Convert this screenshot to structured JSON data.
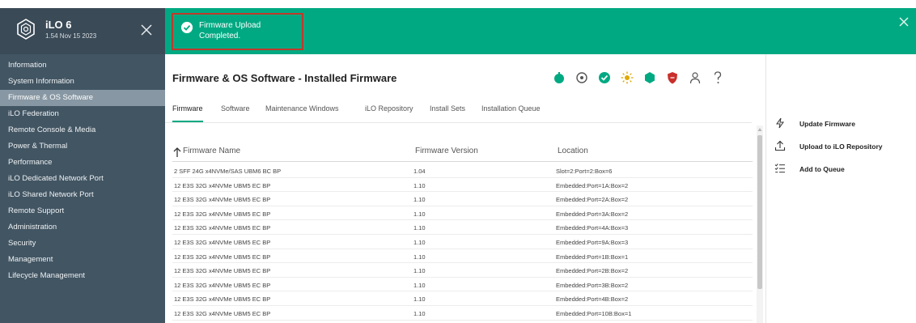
{
  "app": {
    "name": "iLO 6",
    "version": "1.54 Nov 15 2023"
  },
  "sidebar": {
    "items": [
      {
        "label": "Information",
        "active": false
      },
      {
        "label": "System Information",
        "active": false
      },
      {
        "label": "Firmware & OS Software",
        "active": true
      },
      {
        "label": "iLO Federation",
        "active": false
      },
      {
        "label": "Remote Console & Media",
        "active": false
      },
      {
        "label": "Power & Thermal",
        "active": false
      },
      {
        "label": "Performance",
        "active": false
      },
      {
        "label": "iLO Dedicated Network Port",
        "active": false
      },
      {
        "label": "iLO Shared Network Port",
        "active": false
      },
      {
        "label": "Remote Support",
        "active": false
      },
      {
        "label": "Administration",
        "active": false
      },
      {
        "label": "Security",
        "active": false
      },
      {
        "label": "Management",
        "active": false
      },
      {
        "label": "Lifecycle Management",
        "active": false
      }
    ]
  },
  "toast": {
    "message": "Firmware Upload Completed."
  },
  "main": {
    "title": "Firmware & OS Software - Installed Firmware",
    "tabs": [
      {
        "label": "Firmware",
        "active": true
      },
      {
        "label": "Software",
        "active": false
      },
      {
        "label": "Maintenance Windows",
        "active": false
      },
      {
        "label": "iLO Repository",
        "active": false
      },
      {
        "label": "Install Sets",
        "active": false
      },
      {
        "label": "Installation Queue",
        "active": false
      }
    ],
    "table": {
      "headers": [
        "Firmware Name",
        "Firmware Version",
        "Location"
      ],
      "rows": [
        [
          "2 SFF 24G x4NVMe/SAS UBM6 BC BP",
          "1.04",
          "Slot=2:Port=2:Box=6"
        ],
        [
          "12 E3S 32G x4NVMe UBM5 EC BP",
          "1.10",
          "Embedded:Port=1A:Box=2"
        ],
        [
          "12 E3S 32G x4NVMe UBM5 EC BP",
          "1.10",
          "Embedded:Port=2A:Box=2"
        ],
        [
          "12 E3S 32G x4NVMe UBM5 EC BP",
          "1.10",
          "Embedded:Port=3A:Box=2"
        ],
        [
          "12 E3S 32G x4NVMe UBM5 EC BP",
          "1.10",
          "Embedded:Port=4A:Box=3"
        ],
        [
          "12 E3S 32G x4NVMe UBM5 EC BP",
          "1.10",
          "Embedded:Port=9A:Box=3"
        ],
        [
          "12 E3S 32G x4NVMe UBM5 EC BP",
          "1.10",
          "Embedded:Port=1B:Box=1"
        ],
        [
          "12 E3S 32G x4NVMe UBM5 EC BP",
          "1.10",
          "Embedded:Port=2B:Box=2"
        ],
        [
          "12 E3S 32G x4NVMe UBM5 EC BP",
          "1.10",
          "Embedded:Port=3B:Box=2"
        ],
        [
          "12 E3S 32G x4NVMe UBM5 EC BP",
          "1.10",
          "Embedded:Port=4B:Box=2"
        ],
        [
          "12 E3S 32G x4NVMe UBM5 EC BP",
          "1.10",
          "Embedded:Port=10B:Box=1"
        ]
      ]
    }
  },
  "actions": [
    {
      "label": "Update Firmware",
      "icon": "flash-icon"
    },
    {
      "label": "Upload to iLO Repository",
      "icon": "upload-icon"
    },
    {
      "label": "Add to Queue",
      "icon": "add-to-queue-icon"
    }
  ],
  "colors": {
    "brand_green": "#01a982",
    "sidebar_bg": "#425563",
    "sidebar_active": "#8797a3",
    "toast_border": "#c0392b",
    "status_red": "#c9302c"
  }
}
